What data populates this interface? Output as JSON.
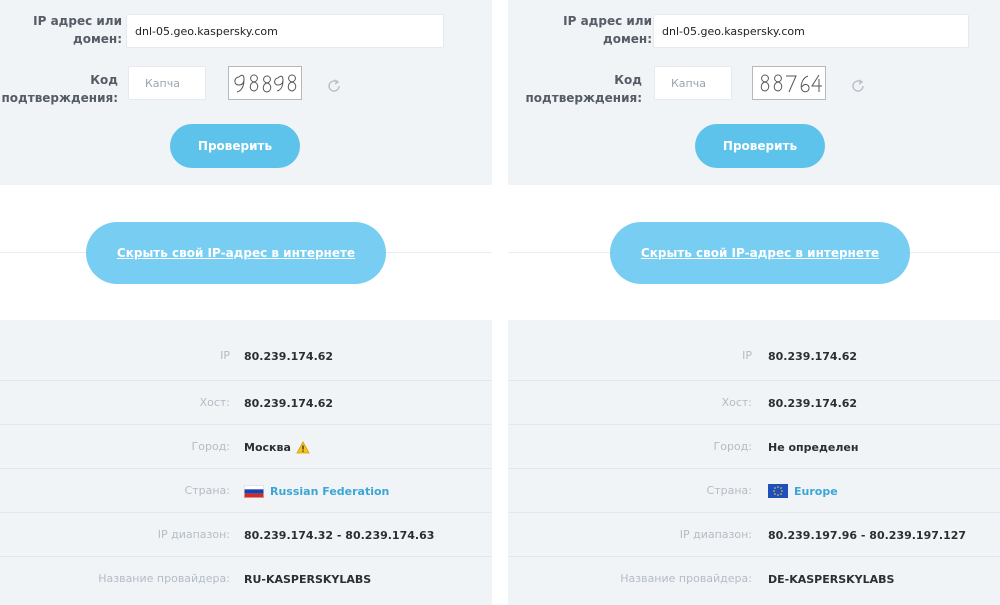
{
  "left": {
    "form": {
      "ip_label_line1": "IP адрес или",
      "ip_label_line2": "домен:",
      "ip_value": "dnl-05.geo.kaspersky.com",
      "code_label_line1": "Код",
      "code_label_line2": "подтверждения:",
      "captcha_placeholder": "Капча",
      "captcha_text": "98898",
      "refresh_icon": "refresh-icon",
      "check_label": "Проверить"
    },
    "hide_ip_label": "Скрыть свой IP-адрес в интернете",
    "results": [
      {
        "label": "IP",
        "value": "80.239.174.62"
      },
      {
        "label": "Хост:",
        "value": "80.239.174.62"
      },
      {
        "label": "Город:",
        "value": "Москва",
        "icon": "warning-icon"
      },
      {
        "label": "Страна:",
        "value": "Russian Federation",
        "icon": "russia-flag-icon"
      },
      {
        "label": "IP диапазон:",
        "value": "80.239.174.32 - 80.239.174.63"
      },
      {
        "label": "Название провайдера:",
        "value": "RU-KASPERSKYLABS"
      }
    ]
  },
  "right": {
    "form": {
      "ip_label_line1": "IP адрес или",
      "ip_label_line2": "домен:",
      "ip_value": "dnl-05.geo.kaspersky.com",
      "code_label_line1": "Код",
      "code_label_line2": "подтверждения:",
      "captcha_placeholder": "Капча",
      "captcha_text": "88764",
      "refresh_icon": "refresh-icon",
      "check_label": "Проверить"
    },
    "hide_ip_label": "Скрыть свой IP-адрес в интернете",
    "results": [
      {
        "label": "IP",
        "value": "80.239.174.62"
      },
      {
        "label": "Хост:",
        "value": "80.239.174.62"
      },
      {
        "label": "Город:",
        "value": "Не определен"
      },
      {
        "label": "Страна:",
        "value": "Europe",
        "icon": "eu-flag-icon"
      },
      {
        "label": "IP диапазон:",
        "value": "80.239.197.96 - 80.239.197.127"
      },
      {
        "label": "Название провайдера:",
        "value": "DE-KASPERSKYLABS"
      }
    ]
  },
  "colors": {
    "panel_bg": "#f1f4f7",
    "button": "#5ec3ea",
    "hide_button": "#77cdf2",
    "link": "#3aa6d6",
    "label_muted": "#b3bcc4"
  }
}
